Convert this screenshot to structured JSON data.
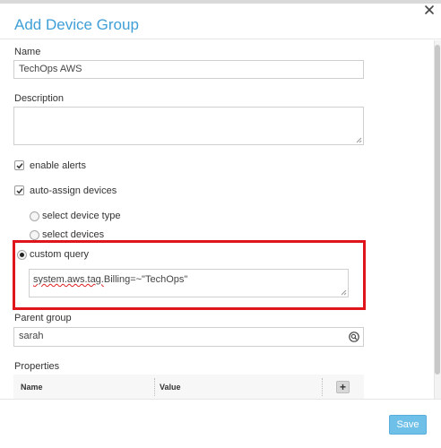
{
  "dialog": {
    "title": "Add Device Group",
    "close_icon": "close-icon"
  },
  "form": {
    "name_label": "Name",
    "name_value": "TechOps AWS",
    "description_label": "Description",
    "description_value": "",
    "enable_alerts_label": "enable alerts",
    "enable_alerts_checked": true,
    "auto_assign_label": "auto-assign devices",
    "auto_assign_checked": true,
    "assign_options": [
      {
        "label": "select device type",
        "selected": false
      },
      {
        "label": "select devices",
        "selected": false
      },
      {
        "label": "custom query",
        "selected": true
      }
    ],
    "custom_query_value_part1": "system.aws.tag.",
    "custom_query_value_part2": "Billing=~\"TechOps\"",
    "parent_group_label": "Parent group",
    "parent_group_value": "sarah",
    "properties_label": "Properties",
    "properties_columns": [
      "Name",
      "Value"
    ],
    "add_property_label": "+"
  },
  "footer": {
    "save_label": "Save"
  },
  "colors": {
    "title": "#3f9fd6",
    "highlight": "#e0141b",
    "save_button": "#6fc0e8"
  }
}
